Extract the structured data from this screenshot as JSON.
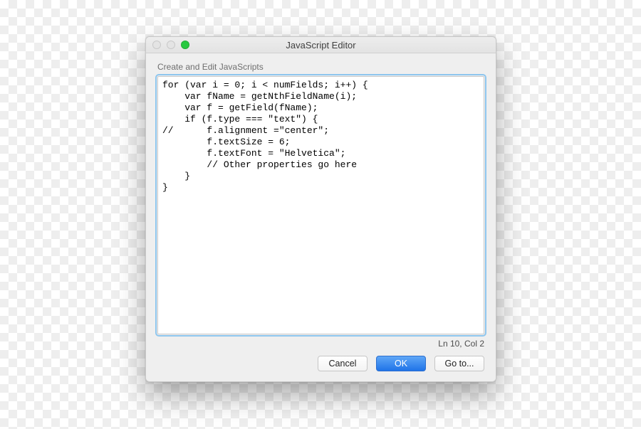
{
  "window": {
    "title": "JavaScript Editor"
  },
  "group_label": "Create and Edit JavaScripts",
  "editor": {
    "code": "for (var i = 0; i < numFields; i++) {\n    var fName = getNthFieldName(i);\n    var f = getField(fName);\n    if (f.type === \"text\") {\n//      f.alignment =\"center\";\n        f.textSize = 6;\n        f.textFont = \"Helvetica\";\n        // Other properties go here\n    }\n}"
  },
  "status": {
    "position": "Ln 10, Col 2"
  },
  "buttons": {
    "cancel": "Cancel",
    "ok": "OK",
    "goto": "Go to..."
  }
}
